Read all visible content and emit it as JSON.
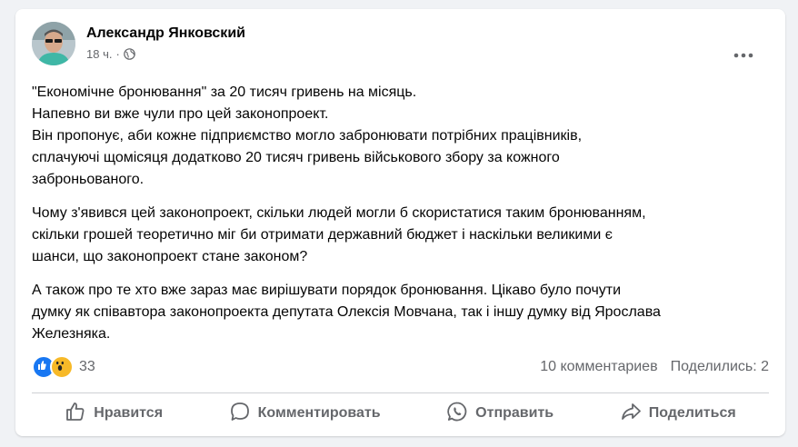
{
  "post": {
    "author": "Александр Янковский",
    "time": "18 ч.",
    "visibility_icon": "globe-icon",
    "paragraphs": [
      [
        "\"Економічне бронювання\" за 20 тисяч гривень на місяць.",
        "Напевно ви вже чули про цей законопроект.",
        "Він пропонує, аби кожне підприємство могло забронювати потрібних працівників,",
        "сплачуючі щомісяця додатково 20 тисяч гривень військового збору за кожного",
        "заброньованого."
      ],
      [
        "Чому з'явився цей законопроект, скільки людей могли б скористатися таким бронюванням,",
        "скільки грошей теоретично міг би отримати державний бюджет і наскільки великими є",
        "шанси, що законопроект стане законом?"
      ],
      [
        "А також про те хто вже зараз має вирішувати порядок бронювання. Цікаво було почути",
        "думку як співавтора законопроекта депутата Олексія Мовчана, так і іншу думку від Ярослава",
        "Железняка."
      ]
    ]
  },
  "stats": {
    "reaction_count": "33",
    "comments": "10 комментариев",
    "shares": "Поделились: 2"
  },
  "actions": {
    "like": "Нравится",
    "comment": "Комментировать",
    "send": "Отправить",
    "share": "Поделиться"
  },
  "colors": {
    "like_blue": "#1877f2",
    "wow_yellow": "#f7b928",
    "secondary_text": "#65676b"
  }
}
